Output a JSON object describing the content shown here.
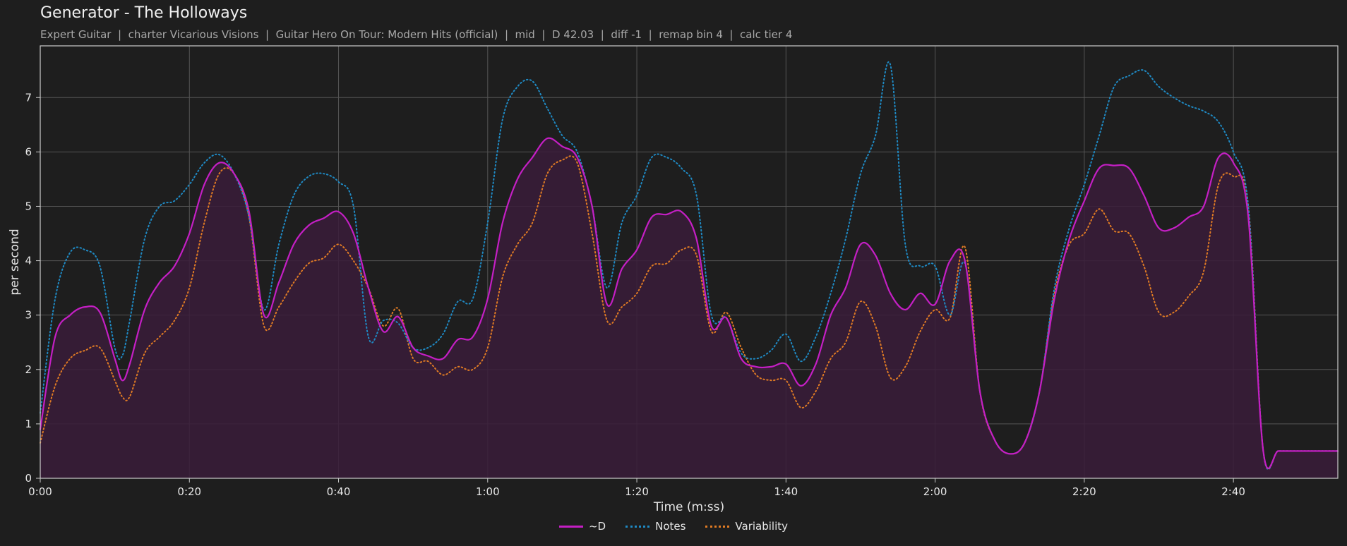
{
  "header": {
    "title": "Generator - The Holloways",
    "subtitle": "Expert Guitar  |  charter Vicarious Visions  |  Guitar Hero On Tour: Modern Hits (official)  |  mid  |  D 42.03  |  diff -1  |  remap bin 4  |  calc tier 4"
  },
  "colors": {
    "background": "#1e1e1e",
    "plot_background": "#1e1e1e",
    "d_series": "#c41fc4",
    "notes_series": "#1f8ac4",
    "variability_series": "#e07b24",
    "fill": "#3a1c3a",
    "grid": "#555555",
    "axis": "#cccccc"
  },
  "chart_data": {
    "type": "line",
    "xlabel": "Time (m:ss)",
    "ylabel": "per second",
    "xlim": [
      0,
      174
    ],
    "ylim": [
      0,
      7.95
    ],
    "grid": true,
    "legend": "bottom-center",
    "xticks": [
      0,
      20,
      40,
      60,
      80,
      100,
      120,
      140,
      160
    ],
    "xtick_labels": [
      "0:00",
      "0:20",
      "0:40",
      "1:00",
      "1:20",
      "1:40",
      "2:00",
      "2:20",
      "2:40"
    ],
    "yticks": [
      0,
      1,
      2,
      3,
      4,
      5,
      6,
      7
    ],
    "x": [
      0,
      2,
      4,
      6,
      8,
      10,
      11,
      12,
      14,
      16,
      18,
      20,
      22,
      24,
      26,
      28,
      30,
      32,
      34,
      36,
      38,
      40,
      42,
      44,
      46,
      48,
      50,
      52,
      54,
      56,
      58,
      60,
      62,
      64,
      66,
      68,
      70,
      72,
      74,
      76,
      78,
      80,
      82,
      84,
      86,
      88,
      90,
      92,
      94,
      96,
      98,
      100,
      102,
      104,
      106,
      108,
      110,
      112,
      114,
      116,
      118,
      120,
      122,
      124,
      126,
      128,
      130,
      132,
      134,
      136,
      138,
      140,
      142,
      144,
      146,
      148,
      150,
      152,
      154,
      156,
      158,
      160,
      162,
      164,
      166,
      168,
      170,
      172,
      174
    ],
    "series": [
      {
        "name": "~D",
        "style": "solid",
        "values": [
          0.9,
          2.6,
          3.0,
          3.15,
          3.05,
          2.2,
          1.8,
          2.1,
          3.1,
          3.6,
          3.9,
          4.5,
          5.4,
          5.8,
          5.6,
          4.9,
          3.0,
          3.6,
          4.3,
          4.65,
          4.78,
          4.9,
          4.5,
          3.5,
          2.7,
          2.97,
          2.4,
          2.25,
          2.2,
          2.55,
          2.6,
          3.3,
          4.7,
          5.5,
          5.9,
          6.25,
          6.1,
          5.9,
          5.0,
          3.2,
          3.85,
          4.2,
          4.8,
          4.85,
          4.9,
          4.4,
          2.8,
          2.95,
          2.2,
          2.05,
          2.05,
          2.1,
          1.7,
          2.1,
          3.0,
          3.5,
          4.3,
          4.1,
          3.4,
          3.1,
          3.4,
          3.2,
          4.0,
          4.0,
          1.6,
          0.7,
          0.45,
          0.65,
          1.6,
          3.3,
          4.4,
          5.1,
          5.7,
          5.75,
          5.7,
          5.2,
          4.6,
          4.6,
          4.8,
          5.0,
          5.9,
          5.8,
          4.8,
          0.5,
          0.5,
          0.5,
          0.5,
          0.5,
          0.5
        ]
      },
      {
        "name": "Notes",
        "style": "dotted",
        "values": [
          1.2,
          3.3,
          4.15,
          4.2,
          3.9,
          2.4,
          2.25,
          2.9,
          4.4,
          5.0,
          5.1,
          5.4,
          5.8,
          5.95,
          5.6,
          4.8,
          3.1,
          4.3,
          5.2,
          5.55,
          5.6,
          5.45,
          5.0,
          2.6,
          2.9,
          2.85,
          2.4,
          2.4,
          2.65,
          3.25,
          3.3,
          4.7,
          6.6,
          7.2,
          7.3,
          6.8,
          6.3,
          6.0,
          5.0,
          3.5,
          4.7,
          5.2,
          5.9,
          5.9,
          5.7,
          5.2,
          3.0,
          2.95,
          2.3,
          2.2,
          2.35,
          2.65,
          2.15,
          2.6,
          3.4,
          4.4,
          5.6,
          6.3,
          7.6,
          4.3,
          3.9,
          3.9,
          3.0,
          3.95,
          1.6,
          0.7,
          0.45,
          0.65,
          1.6,
          3.5,
          4.6,
          5.4,
          6.3,
          7.2,
          7.4,
          7.5,
          7.2,
          7.0,
          6.85,
          6.75,
          6.55,
          6.0,
          5.0,
          0.5,
          0.5,
          0.5,
          0.5,
          0.5,
          0.5
        ]
      },
      {
        "name": "Variability",
        "style": "dotted",
        "values": [
          0.65,
          1.7,
          2.2,
          2.35,
          2.4,
          1.8,
          1.5,
          1.5,
          2.3,
          2.6,
          2.9,
          3.5,
          4.7,
          5.6,
          5.6,
          4.8,
          2.8,
          3.15,
          3.6,
          3.95,
          4.05,
          4.3,
          4.0,
          3.5,
          2.8,
          3.12,
          2.2,
          2.15,
          1.9,
          2.05,
          2.0,
          2.4,
          3.7,
          4.3,
          4.7,
          5.6,
          5.85,
          5.8,
          4.5,
          2.9,
          3.15,
          3.4,
          3.9,
          3.95,
          4.2,
          4.1,
          2.7,
          3.05,
          2.4,
          1.9,
          1.8,
          1.8,
          1.3,
          1.6,
          2.2,
          2.5,
          3.25,
          2.8,
          1.85,
          2.05,
          2.7,
          3.1,
          2.95,
          4.25,
          1.6,
          0.7,
          0.45,
          0.65,
          1.6,
          3.4,
          4.3,
          4.5,
          4.95,
          4.55,
          4.5,
          3.9,
          3.05,
          3.05,
          3.35,
          3.8,
          5.4,
          5.55,
          5.0,
          0.5,
          0.5,
          0.5,
          0.5,
          0.5,
          0.5
        ]
      }
    ]
  }
}
